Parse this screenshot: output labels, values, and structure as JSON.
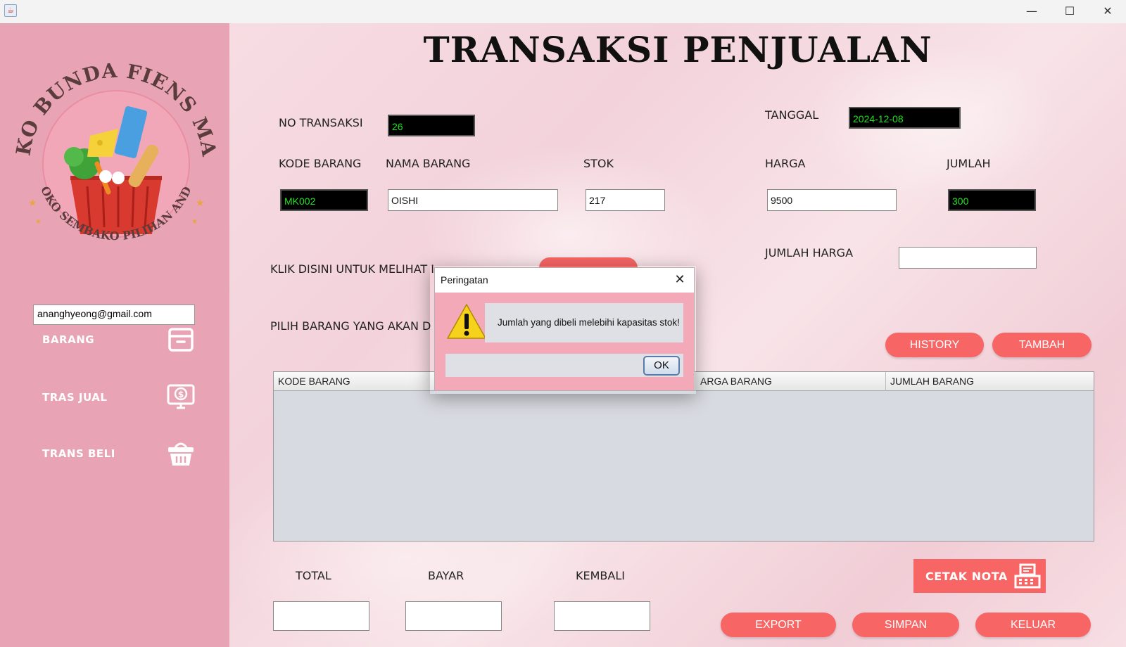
{
  "window": {
    "controls": {
      "minimize": "—",
      "maximize": "☐",
      "close": "✕"
    }
  },
  "sidebar": {
    "logo": {
      "top_text": "TOKO BUNDA FIENS MART",
      "bottom_text": "TOKO SEMBAKO PILIHAN ANDA"
    },
    "email": "ananghyeong@gmail.com",
    "items": [
      {
        "label": "BARANG",
        "icon": "archive-box-icon"
      },
      {
        "label": "TRAS JUAL",
        "icon": "monitor-dollar-icon"
      },
      {
        "label": "TRANS BELI",
        "icon": "shopping-basket-icon"
      }
    ]
  },
  "main": {
    "title": "TRANSAKSI PENJUALAN",
    "no_transaksi": {
      "label": "NO TRANSAKSI",
      "value": "26"
    },
    "tanggal": {
      "label": "TANGGAL",
      "value": "2024-12-08"
    },
    "kode_barang": {
      "label": "KODE BARANG",
      "value": "MK002"
    },
    "nama_barang": {
      "label": "NAMA BARANG",
      "value": "OISHI"
    },
    "stok": {
      "label": "STOK",
      "value": "217"
    },
    "harga": {
      "label": "HARGA",
      "value": "9500"
    },
    "jumlah": {
      "label": "JUMLAH",
      "value": "300"
    },
    "jumlah_harga": {
      "label": "JUMLAH HARGA",
      "value": ""
    },
    "klik_label": "KLIK DISINI UNTUK MELIHAT I",
    "pilih_label": "PILIH BARANG YANG AKAN D",
    "buttons": {
      "history": "HISTORY",
      "tambah": "TAMBAH",
      "cetak_nota": "CETAK NOTA",
      "export": "EXPORT",
      "simpan": "SIMPAN",
      "keluar": "KELUAR"
    },
    "table": {
      "columns": [
        "KODE BARANG",
        "ARGA BARANG",
        "JUMLAH BARANG"
      ]
    },
    "total": {
      "label": "TOTAL",
      "value": ""
    },
    "bayar": {
      "label": "BAYAR",
      "value": ""
    },
    "kembali": {
      "label": "KEMBALI",
      "value": ""
    }
  },
  "dialog": {
    "title": "Peringatan",
    "message": "Jumlah yang dibeli melebihi kapasitas stok!",
    "ok": "OK",
    "icon": "warning-icon"
  },
  "colors": {
    "sidebar": "#e8a4b4",
    "button": "#f76565",
    "dialog_bg": "#f4a9b9",
    "dark_field_text": "#22e022"
  }
}
